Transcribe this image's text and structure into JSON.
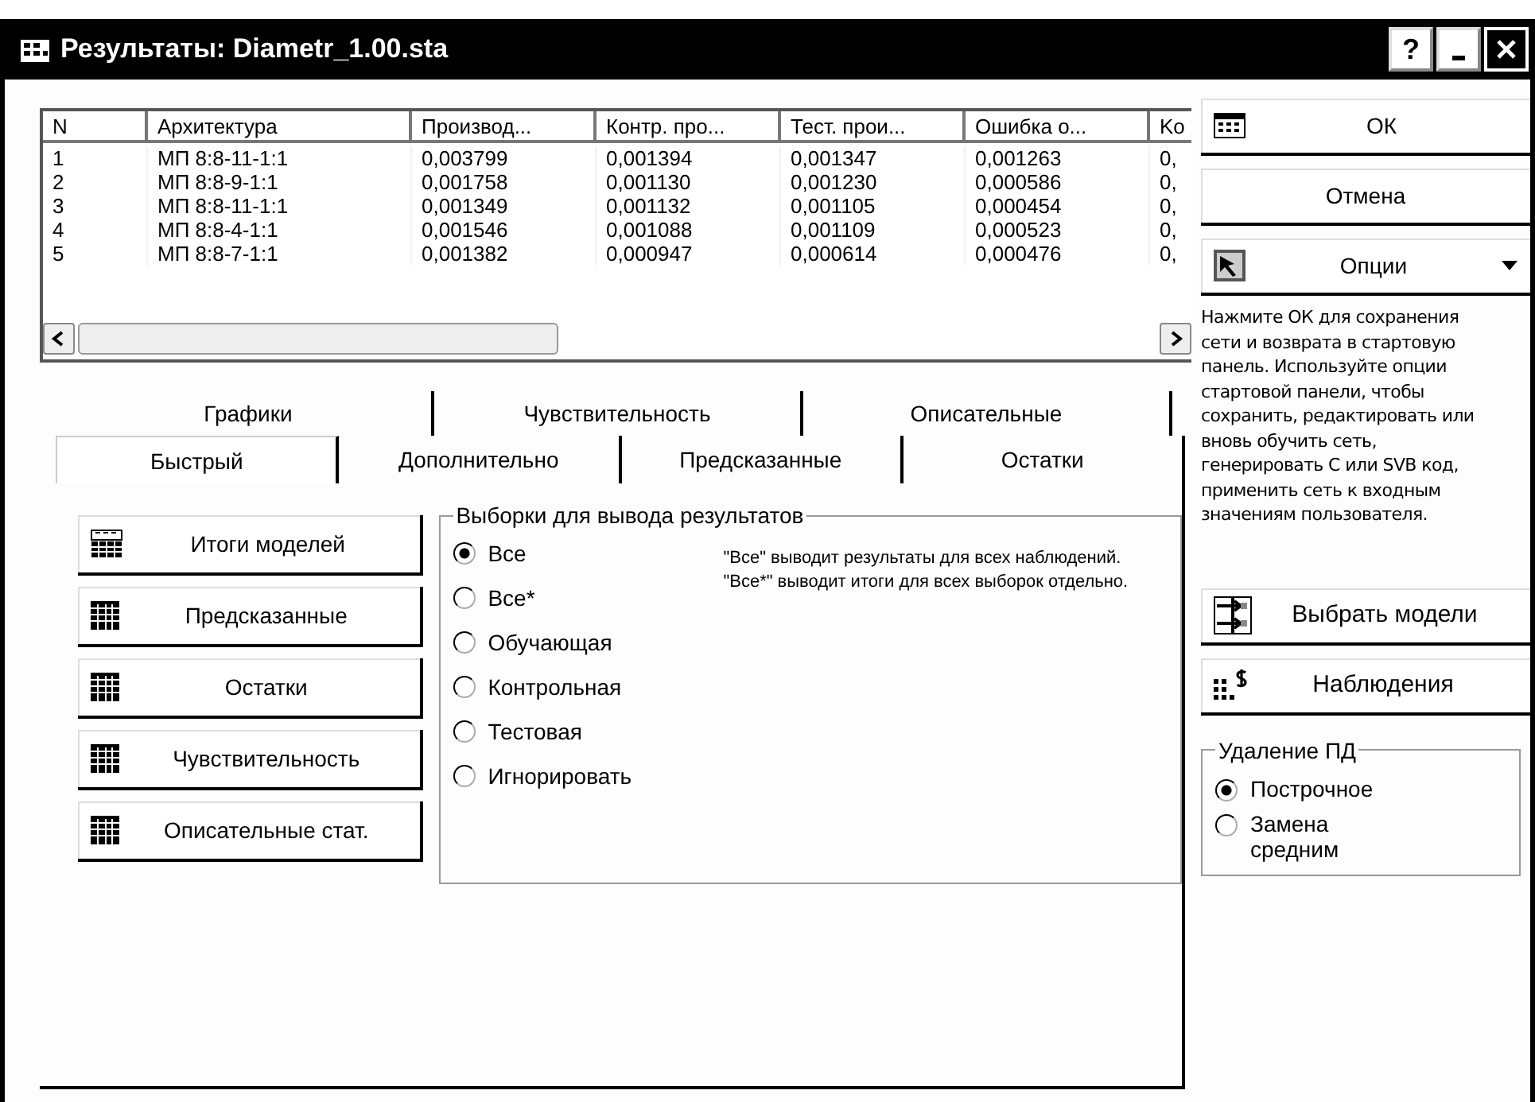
{
  "window": {
    "title": "Результаты: Diametr_1.00.sta",
    "controls": [
      "?"
    ]
  },
  "table": {
    "columns": [
      "N",
      "Архитектура",
      "Производ...",
      "Контр. про...",
      "Тест. прои...",
      "Ошибка о...",
      "Ko"
    ],
    "rows": [
      [
        "1",
        "МП 8:8-11-1:1",
        "0,003799",
        "0,001394",
        "0,001347",
        "0,001263",
        "0,"
      ],
      [
        "2",
        "МП 8:8-9-1:1",
        "0,001758",
        "0,001130",
        "0,001230",
        "0,000586",
        "0,"
      ],
      [
        "3",
        "МП 8:8-11-1:1",
        "0,001349",
        "0,001132",
        "0,001105",
        "0,000454",
        "0,"
      ],
      [
        "4",
        "МП 8:8-4-1:1",
        "0,001546",
        "0,001088",
        "0,001109",
        "0,000523",
        "0,"
      ],
      [
        "5",
        "МП 8:8-7-1:1",
        "0,001382",
        "0,000947",
        "0,000614",
        "0,000476",
        "0,"
      ]
    ]
  },
  "tabs": {
    "back_row": [
      {
        "label": "Графики",
        "selected": false
      },
      {
        "label": "Чувствительность",
        "selected": false
      },
      {
        "label": "Описательные",
        "selected": false
      }
    ],
    "front_row": [
      {
        "label": "Быстрый",
        "selected": true
      },
      {
        "label": "Дополнительно",
        "selected": false
      },
      {
        "label": "Предсказанные",
        "selected": false
      },
      {
        "label": "Остатки",
        "selected": false
      }
    ]
  },
  "quick": {
    "buttons": [
      {
        "label": "Итоги моделей",
        "kind": "summary"
      },
      {
        "label": "Предсказанные",
        "kind": "grid"
      },
      {
        "label": "Остатки",
        "kind": "grid"
      },
      {
        "label": "Чувствительность",
        "kind": "grid"
      },
      {
        "label": "Описательные стат.",
        "kind": "grid"
      }
    ],
    "samples": {
      "title": "Выборки для вывода результатов",
      "options": [
        {
          "label": "Все",
          "selected": true
        },
        {
          "label": "Все*",
          "selected": false
        },
        {
          "label": "Обучающая",
          "selected": false
        },
        {
          "label": "Контрольная",
          "selected": false
        },
        {
          "label": "Тестовая",
          "selected": false
        },
        {
          "label": "Игнорировать",
          "selected": false
        }
      ],
      "note": "\"Все\" выводит результаты для всех наблюдений. \"Все*\" выводит итоги для всех выборок отдельно."
    }
  },
  "side": {
    "ok": "ОК",
    "cancel": "Отмена",
    "options": "Опции",
    "help": "Нажмите ОК для сохранения сети и возврата в стартовую панель. Используйте опции стартовой панели, чтобы сохранить, редактировать или вновь обучить сеть, генерировать С или SVB код, применить сеть к входным значениям пользователя.",
    "select_models": "Выбрать модели",
    "observations": "Наблюдения",
    "missing": {
      "title": "Удаление ПД",
      "options": [
        {
          "label": "Построчное",
          "selected": true
        },
        {
          "label": "Замена средним",
          "selected": false
        }
      ]
    }
  }
}
